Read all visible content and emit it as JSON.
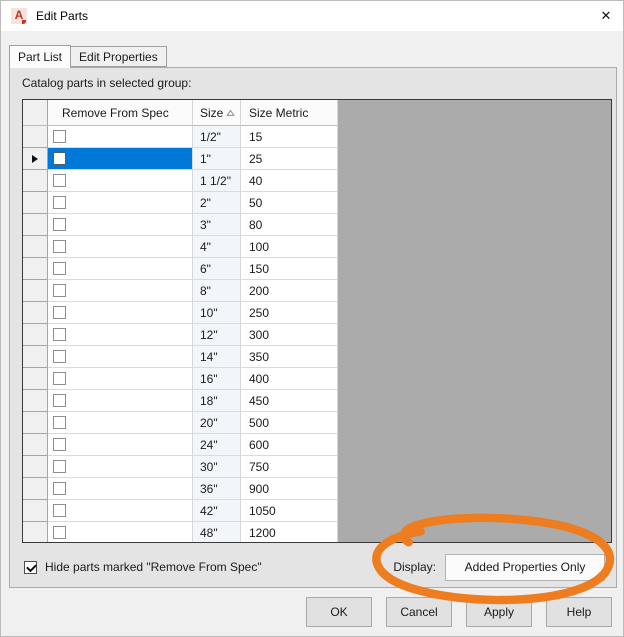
{
  "window": {
    "title": "Edit Parts",
    "app_icon_letter": "A",
    "close_glyph": "✕"
  },
  "tabs": {
    "part_list": "Part List",
    "edit_properties": "Edit Properties"
  },
  "panel": {
    "catalog_label": "Catalog parts in selected group:"
  },
  "grid": {
    "columns": {
      "row_selector": "",
      "remove_from_spec": "Remove From Spec",
      "size": "Size",
      "size_metric": "Size Metric"
    },
    "sort": {
      "column": "Size",
      "direction": "ascending"
    },
    "selected_index": 1,
    "all_checkboxes_unchecked": true,
    "rows": [
      {
        "size": "1/2\"",
        "metric": "15"
      },
      {
        "size": "1\"",
        "metric": "25"
      },
      {
        "size": "1 1/2\"",
        "metric": "40"
      },
      {
        "size": "2\"",
        "metric": "50"
      },
      {
        "size": "3\"",
        "metric": "80"
      },
      {
        "size": "4\"",
        "metric": "100"
      },
      {
        "size": "6\"",
        "metric": "150"
      },
      {
        "size": "8\"",
        "metric": "200"
      },
      {
        "size": "10\"",
        "metric": "250"
      },
      {
        "size": "12\"",
        "metric": "300"
      },
      {
        "size": "14\"",
        "metric": "350"
      },
      {
        "size": "16\"",
        "metric": "400"
      },
      {
        "size": "18\"",
        "metric": "450"
      },
      {
        "size": "20\"",
        "metric": "500"
      },
      {
        "size": "24\"",
        "metric": "600"
      },
      {
        "size": "30\"",
        "metric": "750"
      },
      {
        "size": "36\"",
        "metric": "900"
      },
      {
        "size": "42\"",
        "metric": "1050"
      },
      {
        "size": "48\"",
        "metric": "1200"
      }
    ]
  },
  "footer": {
    "hide_checkbox_label": "Hide parts marked \"Remove From Spec\"",
    "hide_checkbox_checked": true,
    "display_label": "Display:",
    "display_value": "Added Properties Only"
  },
  "buttons": {
    "ok": "OK",
    "cancel": "Cancel",
    "apply": "Apply",
    "help": "Help"
  },
  "colors": {
    "selection_blue": "#0078d7",
    "annotation_orange": "#ee7d1f",
    "grid_filler_gray": "#ababab"
  },
  "annotation": {
    "type": "hand-drawn-ellipse",
    "target": "display-dropdown",
    "color": "#ee7d1f"
  }
}
